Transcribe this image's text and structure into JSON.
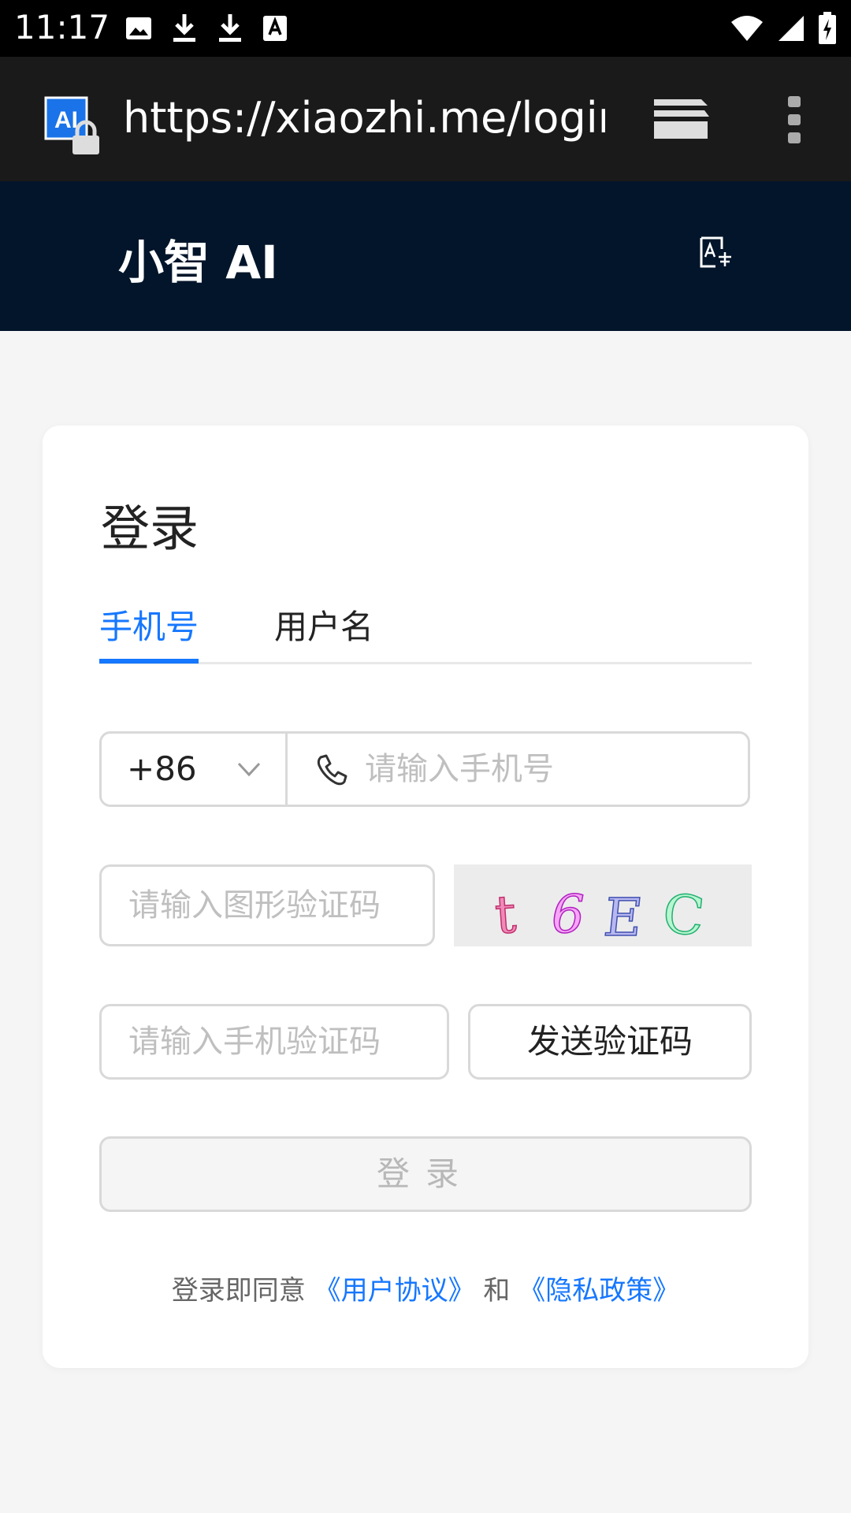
{
  "status_bar": {
    "time": "11:17",
    "icons": [
      "image-icon",
      "download-icon",
      "download-icon",
      "font-icon",
      "wifi-icon",
      "signal-icon",
      "battery-charging-icon"
    ]
  },
  "browser": {
    "url": "https://xiaozhi.me/login?r",
    "site_badge": "AI",
    "icons": [
      "lock-icon",
      "tabs-icon",
      "more-vert-icon"
    ]
  },
  "header": {
    "brand": "小智 AI",
    "translate_icon": "translate-icon"
  },
  "login": {
    "title": "登录",
    "tabs": [
      {
        "label": "手机号",
        "active": true
      },
      {
        "label": "用户名",
        "active": false
      }
    ],
    "country_code": "+86",
    "phone_placeholder": "请输入手机号",
    "captcha_placeholder": "请输入图形验证码",
    "captcha_chars": [
      "t",
      "6",
      "E",
      "C"
    ],
    "sms_placeholder": "请输入手机验证码",
    "send_code_label": "发送验证码",
    "submit_label": "登录",
    "agreement": {
      "prefix": "登录即同意",
      "user_agreement": "《用户协议》",
      "and": "和",
      "privacy_policy": "《隐私政策》"
    }
  },
  "colors": {
    "accent": "#1677ff",
    "header_bg": "#03152a",
    "browser_bg": "#1a1a1a",
    "page_bg": "#f5f5f5"
  }
}
